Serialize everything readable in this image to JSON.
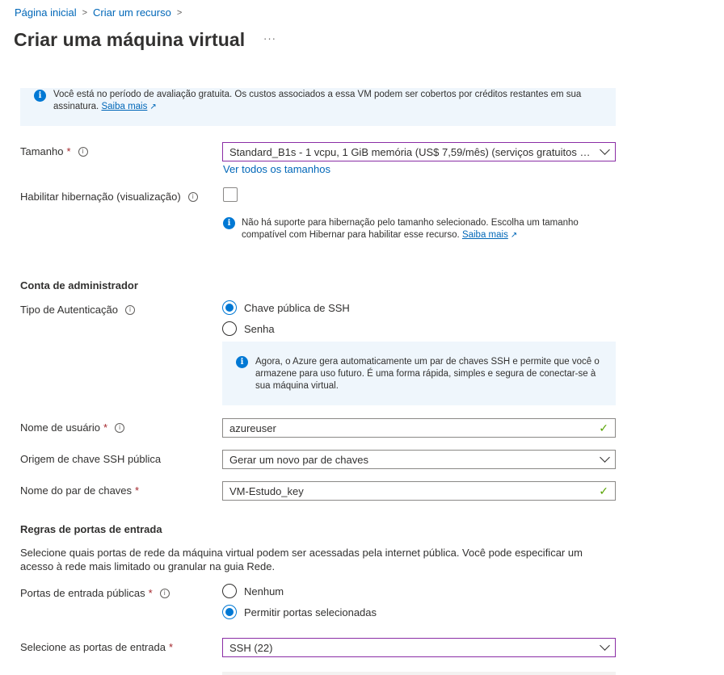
{
  "breadcrumb": [
    "Página inicial",
    "Criar um recurso"
  ],
  "page_title": "Criar uma máquina virtual",
  "more_label": "···",
  "trial_notice": {
    "text": "Você está no período de avaliação gratuita. Os custos associados a essa VM podem ser cobertos por créditos restantes em sua assinatura.",
    "link": "Saiba mais"
  },
  "size": {
    "label": "Tamanho",
    "value": "Standard_B1s - 1 vcpu, 1 GiB memória (US$ 7,59/mês)  (serviços gratuitos qu...",
    "see_all": "Ver todos os tamanhos"
  },
  "hibernation": {
    "label": "Habilitar hibernação (visualização)",
    "checked": false,
    "notice": "Não há suporte para hibernação pelo tamanho selecionado. Escolha um tamanho compatível com Hibernar para habilitar esse recurso.",
    "link": "Saiba mais"
  },
  "admin": {
    "section_title": "Conta de administrador",
    "auth_label": "Tipo de Autenticação",
    "auth_options": [
      "Chave pública de SSH",
      "Senha"
    ],
    "auth_selected": "Chave pública de SSH",
    "ssh_notice": "Agora, o Azure gera automaticamente um par de chaves SSH e permite que você o armazene para uso futuro. É uma forma rápida, simples e segura de conectar-se à sua máquina virtual.",
    "username_label": "Nome de usuário",
    "username_value": "azureuser",
    "ssh_source_label": "Origem de chave SSH pública",
    "ssh_source_value": "Gerar um novo par de chaves",
    "keypair_label": "Nome do par de chaves",
    "keypair_value": "VM-Estudo_key"
  },
  "ports": {
    "section_title": "Regras de portas de entrada",
    "description": "Selecione quais portas de rede da máquina virtual podem ser acessadas pela internet pública. Você pode especificar um acesso à rede mais limitado ou granular na guia Rede.",
    "public_label": "Portas de entrada públicas",
    "public_options": [
      "Nenhum",
      "Permitir portas selecionadas"
    ],
    "public_selected": "Permitir portas selecionadas",
    "select_label": "Selecione as portas de entrada",
    "select_value": "SSH (22)"
  },
  "icons": {
    "info": "info-icon",
    "external": "external-link-icon",
    "chevron": "chevron-down-icon",
    "check": "checkmark-icon",
    "help": "help-icon"
  },
  "colors": {
    "accent": "#0078d4",
    "link": "#0067b8",
    "success": "#57a300",
    "required": "#a4262c",
    "focus": "#8a2da5",
    "info_bg": "#eff6fc"
  }
}
